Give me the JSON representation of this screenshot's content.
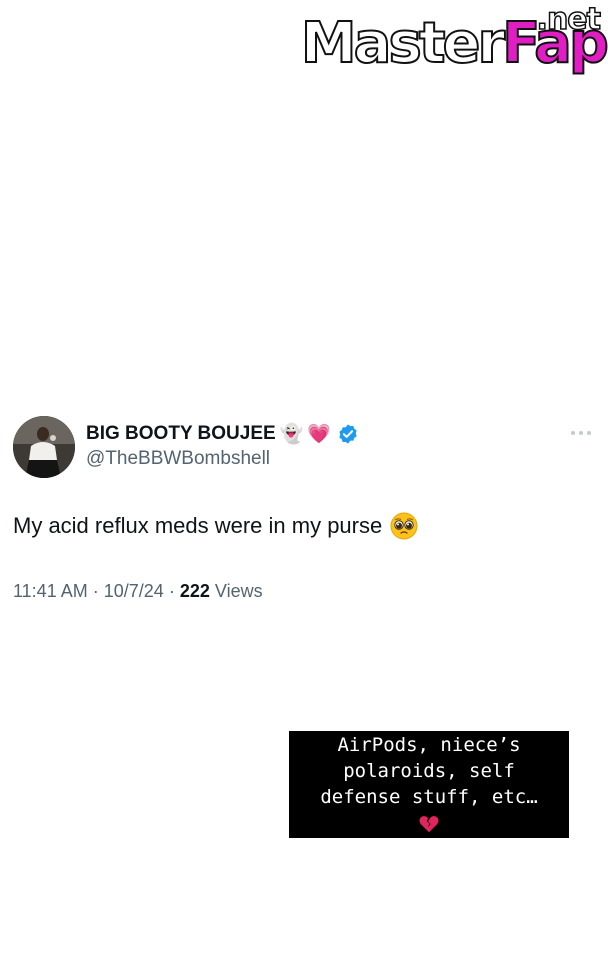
{
  "watermark": {
    "brand_first": "Master",
    "brand_second": "Fap",
    "tld": ".net"
  },
  "tweet": {
    "display_name": "BIG BOOTY BOUJEE",
    "name_emojis": [
      "👻",
      "💗"
    ],
    "handle": "@TheBBWBombshell",
    "text": "My acid reflux meds were in my purse",
    "text_emoji": "pleading-face-icon",
    "time": "11:41 AM",
    "separator": "·",
    "date": "10/7/24",
    "views_count": "222",
    "views_label": "Views",
    "verified_color": "#1d9bf0"
  },
  "caption": {
    "lines": [
      "AirPods, niece’s",
      "polaroids, self",
      "defense stuff, etc…"
    ],
    "emoji": "broken-heart-icon"
  }
}
